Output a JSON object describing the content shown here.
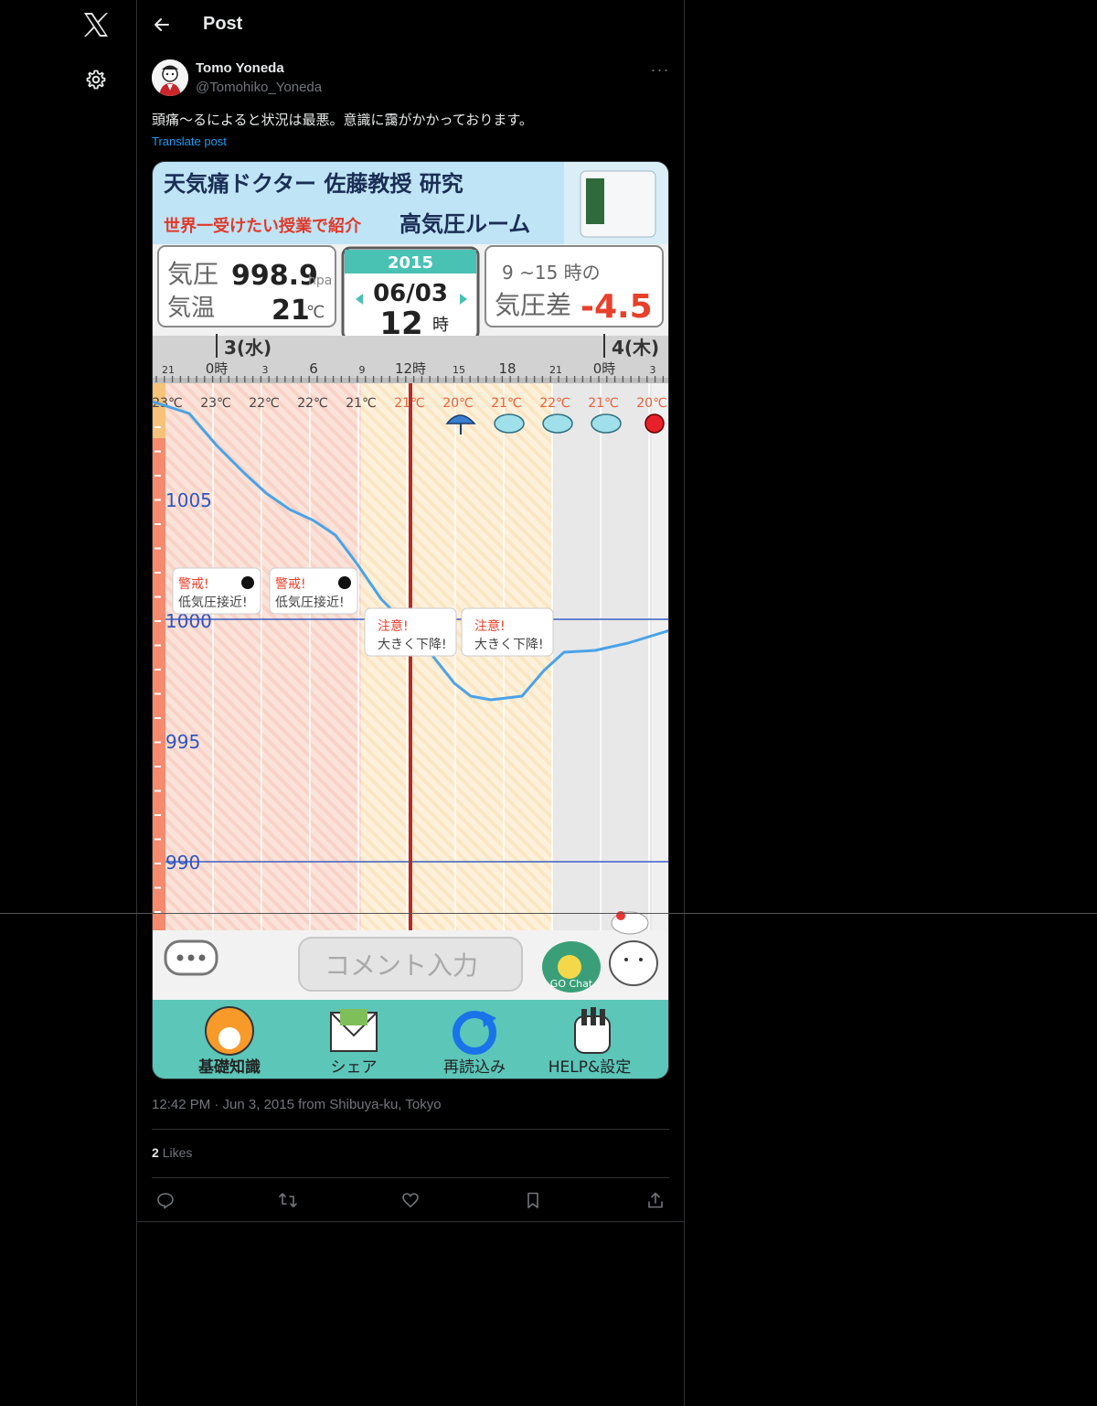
{
  "header": {
    "title": "Post"
  },
  "post": {
    "author_name": "Tomo Yoneda",
    "author_handle": "@Tomohiko_Yoneda",
    "more_label": "···",
    "text": "頭痛〜るによると状況は最悪。意識に靄がかかっております。",
    "translate_label": "Translate post",
    "timestamp": "12:42 PM · Jun 3, 2015 from Shibuya-ku, Tokyo",
    "likes_count": "2",
    "likes_label": "Likes"
  },
  "app": {
    "banner_line1": "天気痛ドクター 佐藤教授 研究",
    "banner_line2": "世界一受けたい授業で紹介",
    "banner_line2b": "高気圧ルーム",
    "pressure_label": "気圧",
    "pressure_value": "998.9",
    "pressure_unit": "hpa",
    "temp_label": "気温",
    "temp_value": "21",
    "temp_unit": "℃",
    "year": "2015",
    "date": "06/03",
    "hour": "12",
    "hour_unit": "時",
    "diff_range": "9 ~15 時の",
    "diff_label": "気圧差",
    "diff_value": "-4.5",
    "day1": "3(水)",
    "day2": "4(木)",
    "ticks": [
      "21",
      "0時",
      "3",
      "6",
      "9",
      "12時",
      "15",
      "18",
      "21",
      "0時",
      "3"
    ],
    "temps": [
      "23℃",
      "23℃",
      "22℃",
      "22℃",
      "21℃",
      "21℃",
      "20℃",
      "21℃",
      "22℃",
      "21℃",
      "20℃"
    ],
    "axis_labels": [
      "1005",
      "1000",
      "995",
      "990"
    ],
    "alert1_title": "警戒!",
    "alert1_text": "低気圧接近!",
    "alert2_title": "注意!",
    "alert2_text": "大きく下降!",
    "comment_placeholder": "コメント入力",
    "go_chat": "GO Chat",
    "tab_labels": [
      "基礎知識",
      "シェア",
      "再読込み",
      "HELP&設定"
    ]
  },
  "colors": {
    "accent": "#1d9bf0",
    "muted": "#71767b",
    "pressure_line": "#4aa3e8",
    "alert_red": "#e8402a"
  }
}
